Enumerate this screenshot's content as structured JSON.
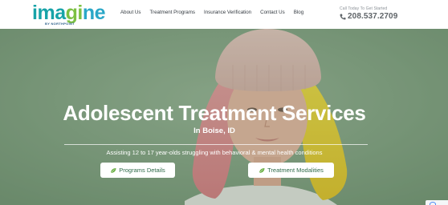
{
  "header": {
    "logo": {
      "word": "imagine",
      "subline": "BY NORTHPOINT",
      "brand_colors": [
        "#16a3a8",
        "#7cc043",
        "#2aa7c7"
      ]
    },
    "nav": [
      {
        "label": "About Us"
      },
      {
        "label": "Treatment Programs"
      },
      {
        "label": "Insurance Verification"
      },
      {
        "label": "Contact Us"
      },
      {
        "label": "Blog"
      }
    ],
    "cta": {
      "label": "Call Today To Get Started",
      "phone": "208.537.2709",
      "icon": "phone-icon"
    }
  },
  "hero": {
    "title": "Adolescent Treatment Services",
    "location": "In Boise, ID",
    "subtitle": "Assisting 12 to 17 year-olds struggling with behavioral & mental health conditions",
    "buttons": [
      {
        "label": "Programs Details",
        "icon": "leaf-icon"
      },
      {
        "label": "Treatment Modalities",
        "icon": "leaf-icon"
      }
    ],
    "background_color": "#7d9f7c",
    "button_text_color": "#2f6b4a"
  }
}
